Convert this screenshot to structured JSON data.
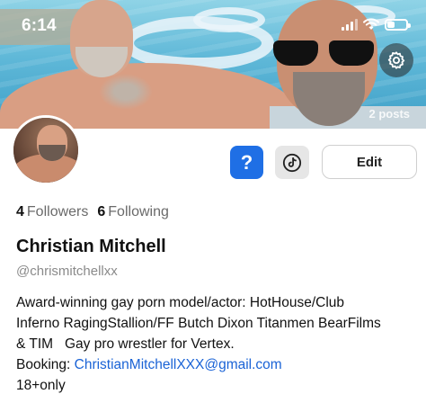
{
  "status_bar": {
    "time": "6:14",
    "battery_percent": 40
  },
  "cover": {
    "posts_label": "2 posts"
  },
  "actions": {
    "question_label": "?",
    "edit_label": "Edit"
  },
  "profile": {
    "followers_count": "4",
    "followers_label": "Followers",
    "following_count": "6",
    "following_label": "Following",
    "name": "Christian Mitchell",
    "handle": "@chrismitchellxx",
    "bio_lines": [
      "Award-winning gay porn model/actor: HotHouse/Club",
      "Inferno RagingStallion/FF Butch Dixon Titanmen BearFilms",
      "& TIM   Gay pro wrestler for Vertex."
    ],
    "booking_prefix": "Booking: ",
    "booking_email": "ChristianMitchellXXX@gmail.com",
    "age_note": "18+only"
  },
  "colors": {
    "accent_blue": "#1f6fe5",
    "link_blue": "#1a63d6",
    "muted_text": "#8a8a8a"
  },
  "icons": {
    "settings": "gear-icon",
    "tiktok": "tiktok-icon",
    "signal": "cellular-signal-icon",
    "wifi": "wifi-icon",
    "battery": "battery-icon"
  }
}
